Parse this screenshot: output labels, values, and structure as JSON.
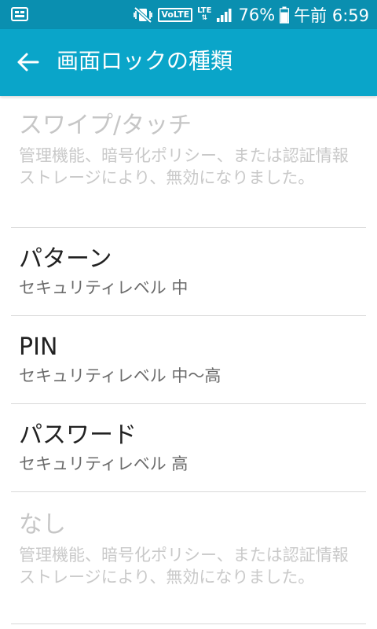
{
  "status_bar": {
    "left_icon": "notification-badge-icon",
    "mute_icon": "vibrate-mute-icon",
    "volte_label": "VoLTE",
    "lte_label": "LTE",
    "signal_icon": "signal-bars-icon",
    "battery_percent": "76%",
    "battery_level": 0.76,
    "time": "午前 6:59",
    "bg_color": "#0a8fb0"
  },
  "app_bar": {
    "back_icon": "back-arrow-icon",
    "title": "画面ロックの種類",
    "bg_color": "#0aa5c9"
  },
  "items": [
    {
      "title": "スワイプ/タッチ",
      "subtitle": "管理機能、暗号化ポリシー、または認証情報ストレージにより、無効になりました。",
      "disabled": true
    },
    {
      "title": "パターン",
      "subtitle": "セキュリティレベル 中",
      "disabled": false
    },
    {
      "title": "PIN",
      "subtitle": "セキュリティレベル 中～高",
      "disabled": false
    },
    {
      "title": "パスワード",
      "subtitle": "セキュリティレベル 高",
      "disabled": false
    },
    {
      "title": "なし",
      "subtitle": "管理機能、暗号化ポリシー、または認証情報ストレージにより、無効になりました。",
      "disabled": true
    }
  ]
}
